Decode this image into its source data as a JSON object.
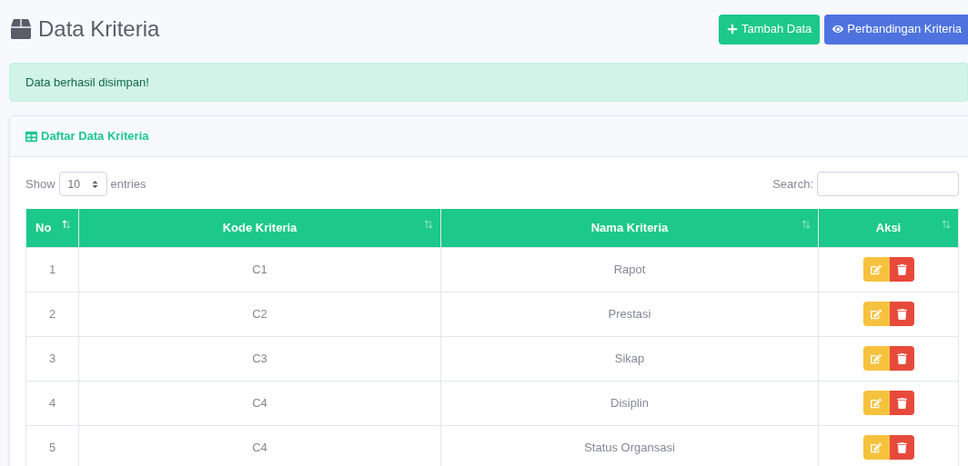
{
  "page_title": "Data Kriteria",
  "header_buttons": [
    {
      "label": "Tambah Data",
      "kind": "add"
    },
    {
      "label": "Perbandingan Kriteria",
      "kind": "compare"
    }
  ],
  "alert": "Data berhasil disimpan!",
  "card": {
    "title": "Daftar Data Kriteria",
    "length_menu": {
      "before": "Show",
      "value": "10",
      "after": "entries"
    },
    "search": {
      "label": "Search:"
    },
    "table": {
      "columns": [
        {
          "label": "No",
          "sorted": true
        },
        {
          "label": "Kode Kriteria",
          "sorted": false
        },
        {
          "label": "Nama Kriteria",
          "sorted": false
        },
        {
          "label": "Aksi",
          "sorted": false
        }
      ],
      "rows": [
        [
          "1",
          "C1",
          "Rapot"
        ],
        [
          "2",
          "C2",
          "Prestasi"
        ],
        [
          "3",
          "C3",
          "Sikap"
        ],
        [
          "4",
          "C4",
          "Disiplin"
        ],
        [
          "5",
          "C4",
          "Status Organsasi"
        ]
      ]
    }
  }
}
